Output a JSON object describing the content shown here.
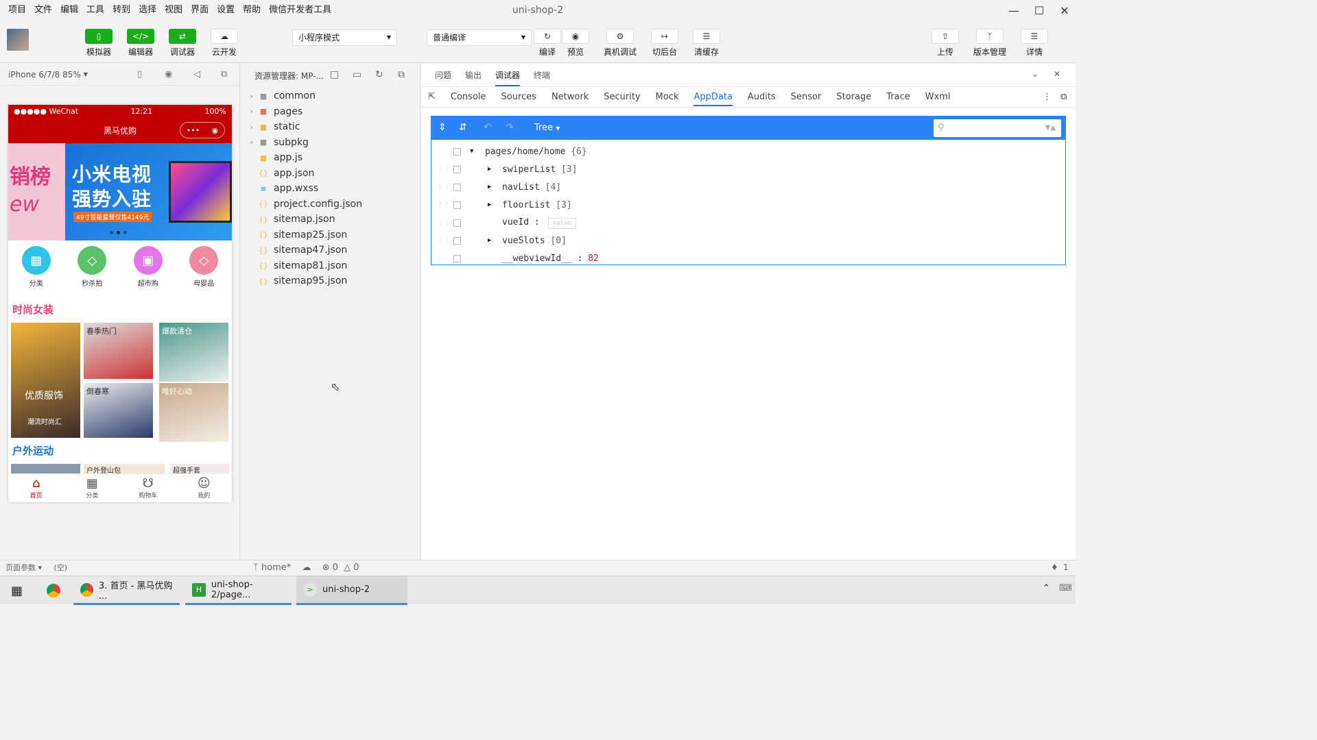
{
  "window": {
    "title": "uni-shop-2",
    "menus": [
      "项目",
      "文件",
      "编辑",
      "工具",
      "转到",
      "选择",
      "视图",
      "界面",
      "设置",
      "帮助",
      "微信开发者工具"
    ]
  },
  "toolbar": {
    "simulator": "模拟器",
    "editor": "编辑器",
    "debugger": "调试器",
    "cloud": "云开发",
    "mode": "小程序模式",
    "compile_mode": "普通编译",
    "compile": "编译",
    "preview": "预览",
    "real_debug": "真机调试",
    "background": "切后台",
    "clear_cache": "清缓存",
    "upload": "上传",
    "version": "版本管理",
    "details": "详情"
  },
  "simulator": {
    "device": "iPhone 6/7/8 85%",
    "status_carrier": "●●●●● WeChat",
    "status_time": "12:21",
    "status_battery": "100%",
    "nav_title": "黑马优购",
    "banner_side": "销榜",
    "banner_side2": "ew",
    "banner_title1": "小米电视",
    "banner_title2": "强势入驻",
    "banner_tag": "49寸智能套餐仅售4149元",
    "nav_items": [
      {
        "label": "分类",
        "color": "#2fc3e8",
        "icon": "grid"
      },
      {
        "label": "秒杀拍",
        "color": "#5bc46b",
        "icon": "tag"
      },
      {
        "label": "超市购",
        "color": "#e477e8",
        "icon": "bag"
      },
      {
        "label": "母婴品",
        "color": "#f08aa0",
        "icon": "tag"
      }
    ],
    "floor1_title": "时尚女装",
    "floor1_cells": [
      "优质服饰",
      "春季热门",
      "爆款清仓",
      "倒春寒",
      "唯好心动"
    ],
    "floor1_sub": "潮流时尚汇",
    "floor2_title": "户外运动",
    "floor2_cells": [
      "户外登山包",
      "超强手套"
    ],
    "tabs": [
      "首页",
      "分类",
      "购物车",
      "我的"
    ],
    "footer": "页面参数 ▾",
    "footer2": "(空)"
  },
  "explorer": {
    "title": "资源管理器: MP-...",
    "files": [
      {
        "name": "common",
        "type": "folder",
        "color": "#999"
      },
      {
        "name": "pages",
        "type": "folder",
        "color": "#e8725a"
      },
      {
        "name": "static",
        "type": "folder",
        "color": "#e8b94a"
      },
      {
        "name": "subpkg",
        "type": "folder",
        "color": "#999"
      },
      {
        "name": "app.js",
        "type": "js",
        "color": "#e8c34a"
      },
      {
        "name": "app.json",
        "type": "json",
        "color": "#e8c34a"
      },
      {
        "name": "app.wxss",
        "type": "wxss",
        "color": "#3b8ad8"
      },
      {
        "name": "project.config.json",
        "type": "json",
        "color": "#e8c34a"
      },
      {
        "name": "sitemap.json",
        "type": "json",
        "color": "#e8c34a"
      },
      {
        "name": "sitemap25.json",
        "type": "json",
        "color": "#e8c34a"
      },
      {
        "name": "sitemap47.json",
        "type": "json",
        "color": "#e8c34a"
      },
      {
        "name": "sitemap81.json",
        "type": "json",
        "color": "#e8c34a"
      },
      {
        "name": "sitemap95.json",
        "type": "json",
        "color": "#e8c34a"
      }
    ],
    "branch": "home*",
    "errors": "0",
    "warnings": "0"
  },
  "devtools": {
    "top_tabs": [
      "问题",
      "输出",
      "调试器",
      "终端"
    ],
    "active_top": "调试器",
    "tabs": [
      "Console",
      "Sources",
      "Network",
      "Security",
      "Mock",
      "AppData",
      "Audits",
      "Sensor",
      "Storage",
      "Trace",
      "Wxml"
    ],
    "active_tab": "AppData",
    "view_mode": "Tree",
    "root": "pages/home/home",
    "root_count": "{6}",
    "rows": [
      {
        "key": "swiperList",
        "count": "[3]"
      },
      {
        "key": "navList",
        "count": "[4]"
      },
      {
        "key": "floorList",
        "count": "[3]"
      },
      {
        "key": "vueId",
        "value": "value"
      },
      {
        "key": "vueSlots",
        "count": "[0]"
      },
      {
        "key": "__webviewId__",
        "value": "82"
      }
    ],
    "notice": "1"
  },
  "taskbar": {
    "items": [
      "3. 首页 - 黑马优购 ...",
      "uni-shop-2/page...",
      "uni-shop-2"
    ]
  }
}
